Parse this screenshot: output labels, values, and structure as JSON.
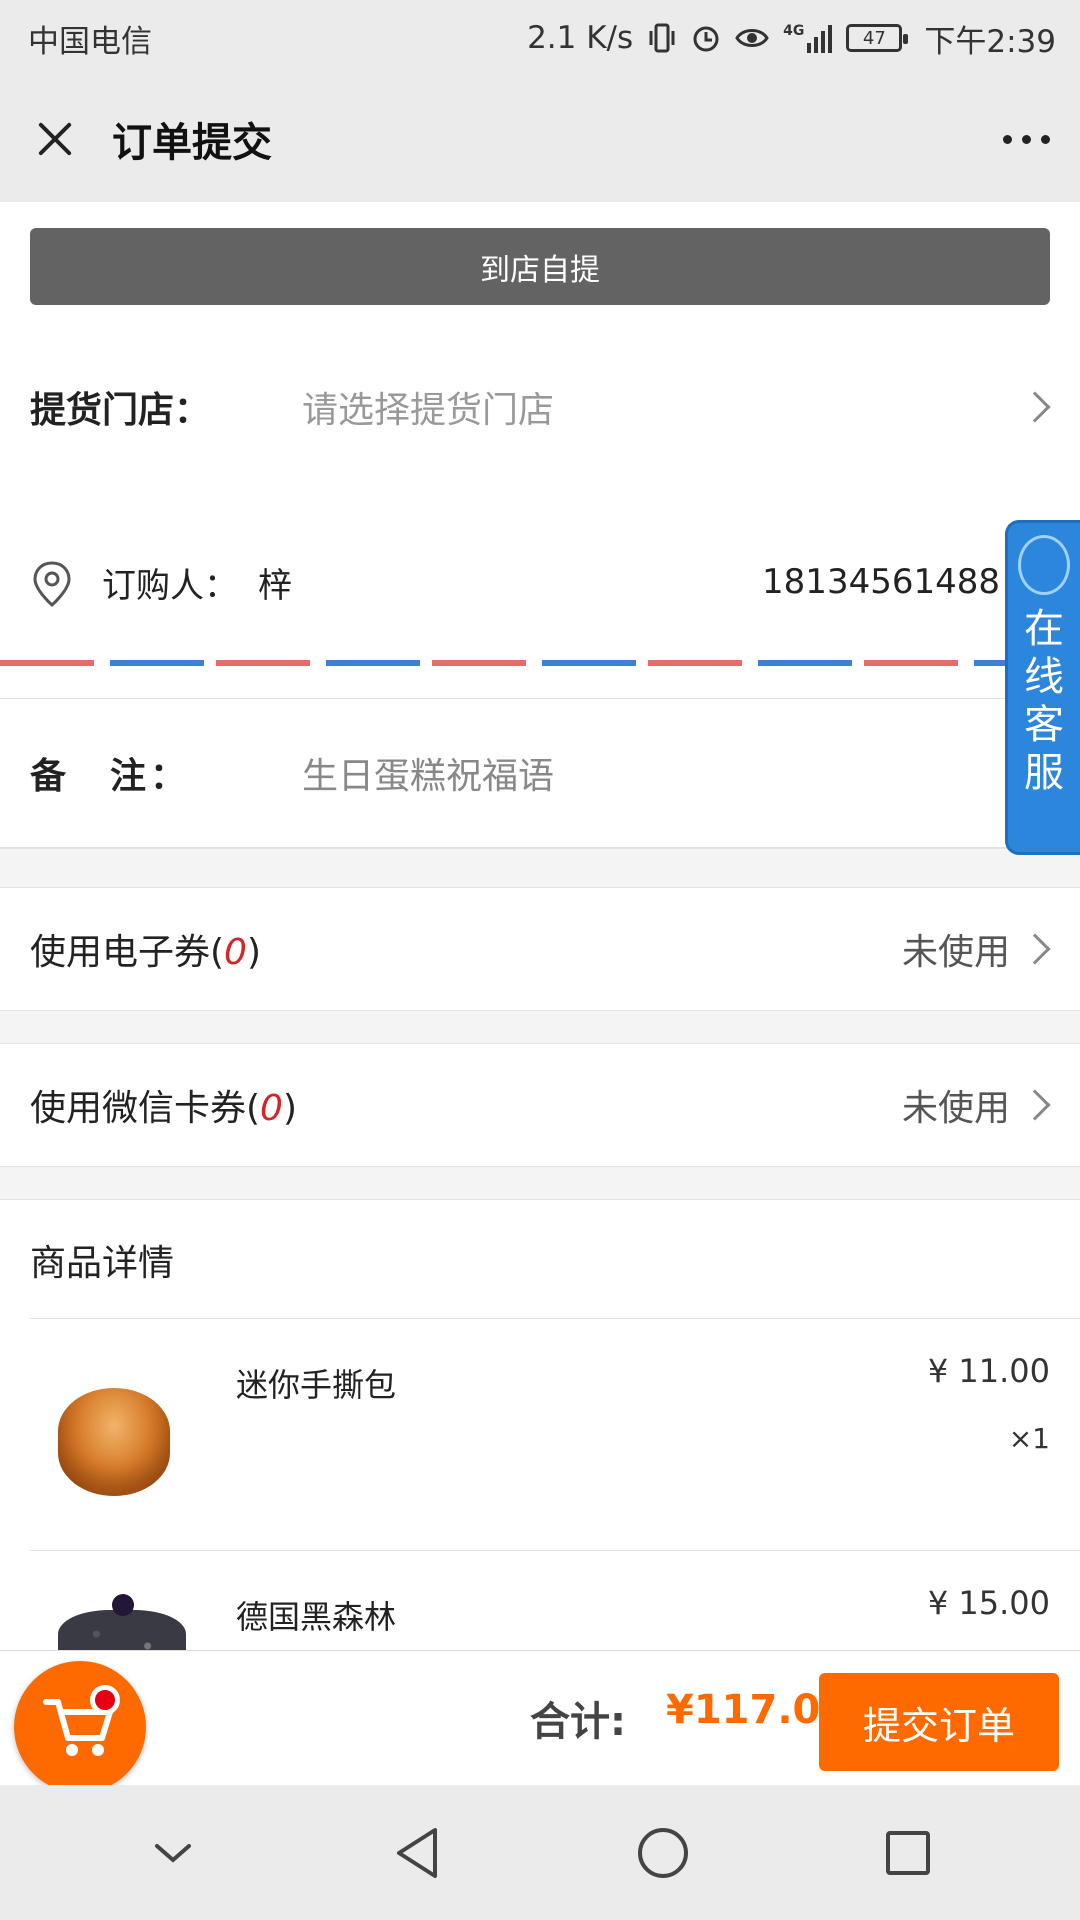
{
  "status_bar": {
    "carrier": "中国电信",
    "speed": "2.1 K/s",
    "battery": "47",
    "time": "下午2:39",
    "network": "4G"
  },
  "header": {
    "title": "订单提交",
    "close_icon": "close-icon",
    "more_icon": "more-icon"
  },
  "pickup": {
    "button_label": "到店自提"
  },
  "store": {
    "label": "提货门店：",
    "placeholder": "请选择提货门店"
  },
  "buyer": {
    "label": "订购人：",
    "name": "梓",
    "phone": "18134561488"
  },
  "note": {
    "label": "备　注：",
    "placeholder": "生日蛋糕祝福语"
  },
  "coupons": [
    {
      "label": "使用电子券(",
      "count": "0",
      "suffix": ")",
      "status": "未使用"
    },
    {
      "label": "使用微信卡券(",
      "count": "0",
      "suffix": ")",
      "status": "未使用"
    }
  ],
  "products": {
    "section_title": "商品详情",
    "items": [
      {
        "name": "迷你手撕包",
        "price": "¥ 11.00",
        "qty": "×1"
      },
      {
        "name": "德国黑森林",
        "price": "¥ 15.00",
        "qty": ""
      }
    ]
  },
  "service": {
    "label": "在线客服"
  },
  "footer": {
    "total_label": "合计:",
    "total_value": "¥117.00",
    "submit_label": "提交订单"
  },
  "colors": {
    "accent": "#ff6a00",
    "service_blue": "#2b86dc",
    "count_red": "#d8232a",
    "pickup_gray": "#636363"
  },
  "navbar": {
    "icons": [
      "chevron-down-icon",
      "back-triangle-icon",
      "home-circle-icon",
      "recent-square-icon"
    ]
  }
}
